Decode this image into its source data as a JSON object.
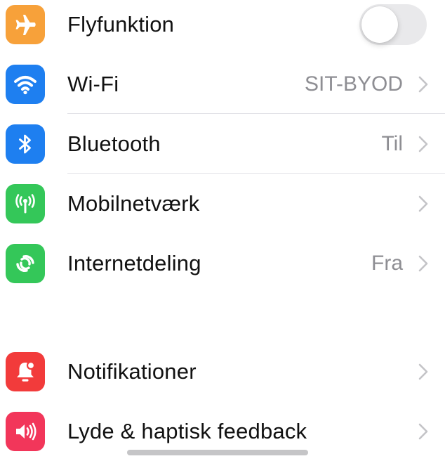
{
  "colors": {
    "airplane": "#f7a13a",
    "wifi": "#1e7ff0",
    "bluetooth": "#1e7ff0",
    "cellular": "#34c759",
    "hotspot": "#34c759",
    "notifications": "#f23b3b",
    "sounds": "#f2365a"
  },
  "connectivity": [
    {
      "label": "Flyfunktion",
      "icon": "airplane-icon",
      "control": "toggle",
      "toggle_on": false
    },
    {
      "label": "Wi-Fi",
      "icon": "wifi-icon",
      "value": "SIT-BYOD"
    },
    {
      "label": "Bluetooth",
      "icon": "bluetooth-icon",
      "value": "Til"
    },
    {
      "label": "Mobilnetværk",
      "icon": "cellular-icon",
      "value": ""
    },
    {
      "label": "Internetdeling",
      "icon": "hotspot-icon",
      "value": "Fra"
    }
  ],
  "alerts": [
    {
      "label": "Notifikationer",
      "icon": "notifications-icon"
    },
    {
      "label": "Lyde & haptisk feedback",
      "icon": "sounds-icon"
    }
  ]
}
